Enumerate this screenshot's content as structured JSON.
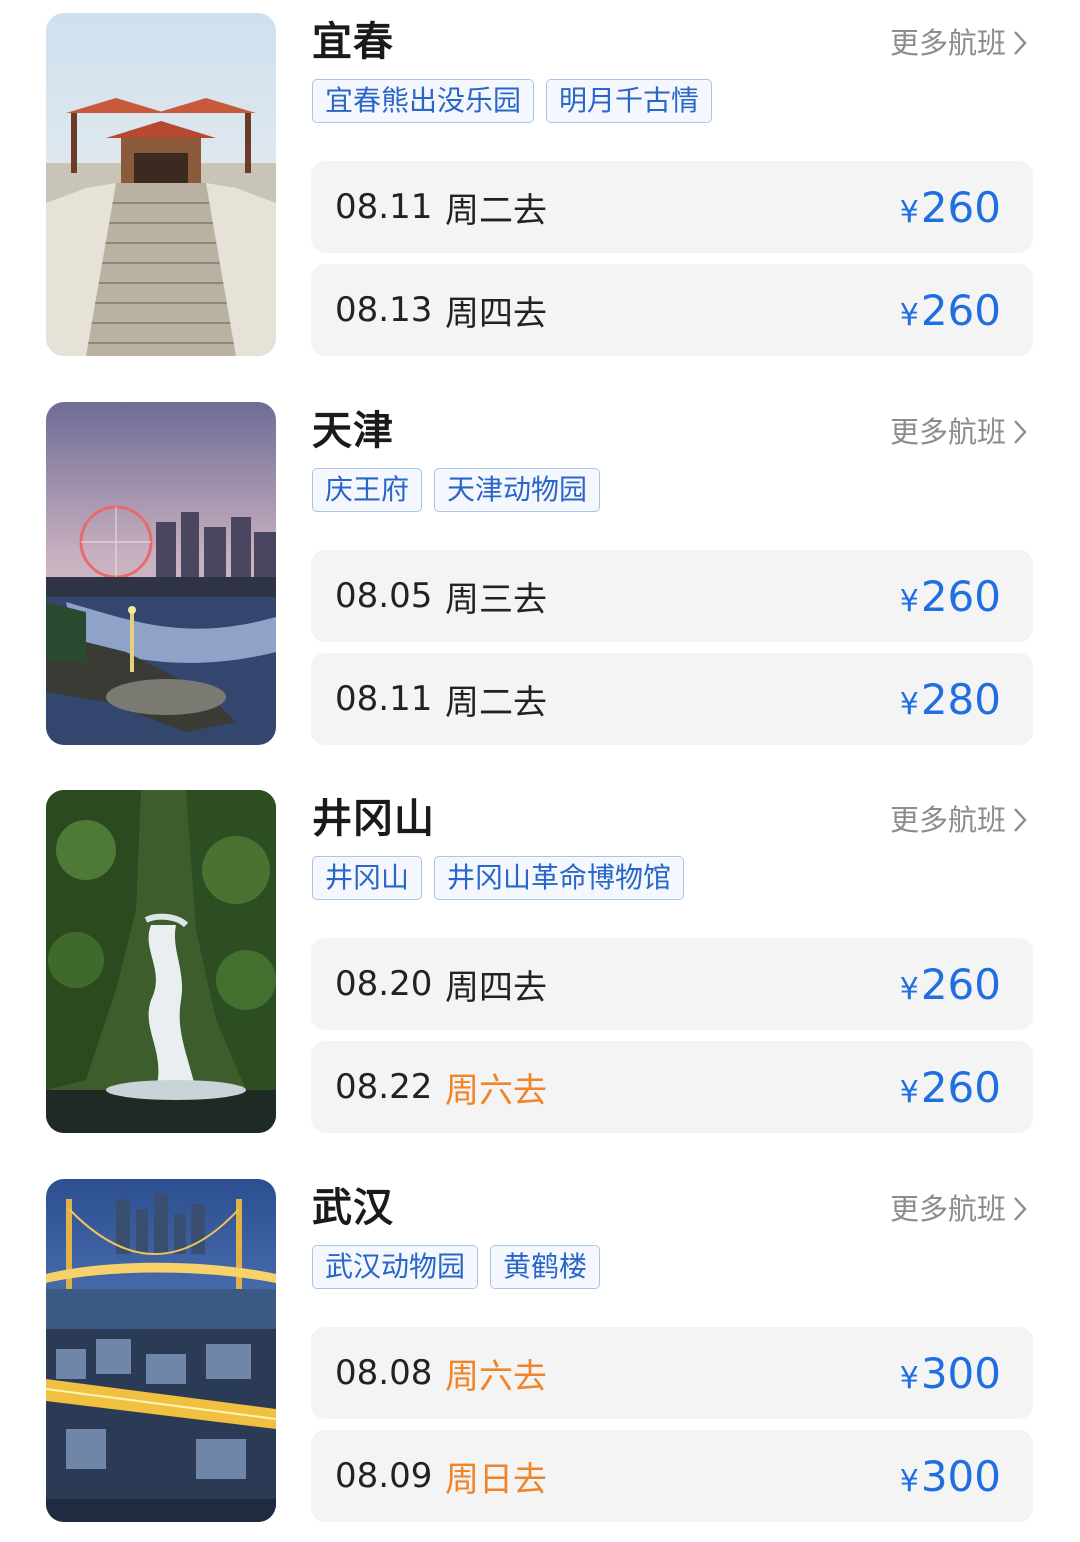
{
  "more_label": "更多航班",
  "colors": {
    "price": "#1f6fe0",
    "weekend": "#f08428",
    "tag_text": "#2a66c8",
    "tag_border": "#a9c4e8",
    "row_bg": "#f4f4f4"
  },
  "currency": "¥",
  "cards": [
    {
      "city": "宜春",
      "image": "ornate-pavilion-stone-stairs",
      "tags": [
        "宜春熊出没乐园",
        "明月千古情"
      ],
      "flights": [
        {
          "date": "08.11",
          "day": "周二去",
          "weekend": false,
          "price": "260"
        },
        {
          "date": "08.13",
          "day": "周四去",
          "weekend": false,
          "price": "260"
        }
      ]
    },
    {
      "city": "天津",
      "image": "ferris-wheel-river-dusk",
      "tags": [
        "庆王府",
        "天津动物园"
      ],
      "flights": [
        {
          "date": "08.05",
          "day": "周三去",
          "weekend": false,
          "price": "260"
        },
        {
          "date": "08.11",
          "day": "周二去",
          "weekend": false,
          "price": "280"
        }
      ]
    },
    {
      "city": "井冈山",
      "image": "forest-waterfall",
      "tags": [
        "井冈山",
        "井冈山革命博物馆"
      ],
      "flights": [
        {
          "date": "08.20",
          "day": "周四去",
          "weekend": false,
          "price": "260"
        },
        {
          "date": "08.22",
          "day": "周六去",
          "weekend": true,
          "price": "260"
        }
      ]
    },
    {
      "city": "武汉",
      "image": "illuminated-bridges-night",
      "tags": [
        "武汉动物园",
        "黄鹤楼"
      ],
      "flights": [
        {
          "date": "08.08",
          "day": "周六去",
          "weekend": true,
          "price": "300"
        },
        {
          "date": "08.09",
          "day": "周日去",
          "weekend": true,
          "price": "300"
        }
      ]
    }
  ]
}
